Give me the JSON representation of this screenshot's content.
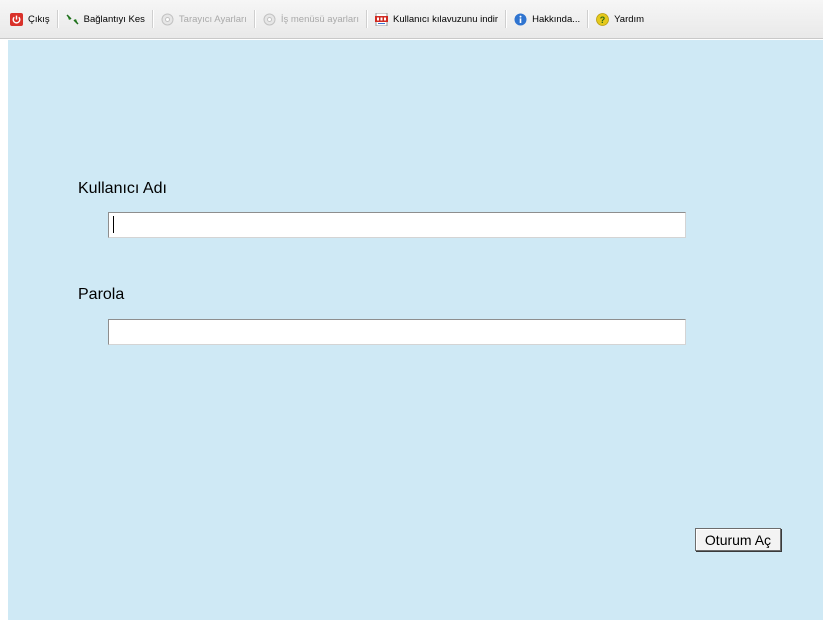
{
  "toolbar": {
    "items": [
      {
        "label": "Çıkış",
        "icon": "power-icon",
        "enabled": true
      },
      {
        "label": "Bağlantıyı Kes",
        "icon": "disconnect-icon",
        "enabled": true
      },
      {
        "label": "Tarayıcı Ayarları",
        "icon": "gear-icon",
        "enabled": false
      },
      {
        "label": "İş menüsü ayarları",
        "icon": "gear-icon",
        "enabled": false
      },
      {
        "label": "Kullanıcı kılavuzunu indir",
        "icon": "pdf-icon",
        "enabled": true
      },
      {
        "label": "Hakkında...",
        "icon": "info-icon",
        "enabled": true
      },
      {
        "label": "Yardım",
        "icon": "help-icon",
        "enabled": true
      }
    ]
  },
  "login": {
    "username_label": "Kullanıcı Adı",
    "username_value": "",
    "password_label": "Parola",
    "password_value": "",
    "submit_label": "Oturum Aç"
  },
  "colors": {
    "panel_background": "#cfe9f5",
    "toolbar_background": "#eeeeee",
    "disabled_text": "#a9a9a9"
  }
}
